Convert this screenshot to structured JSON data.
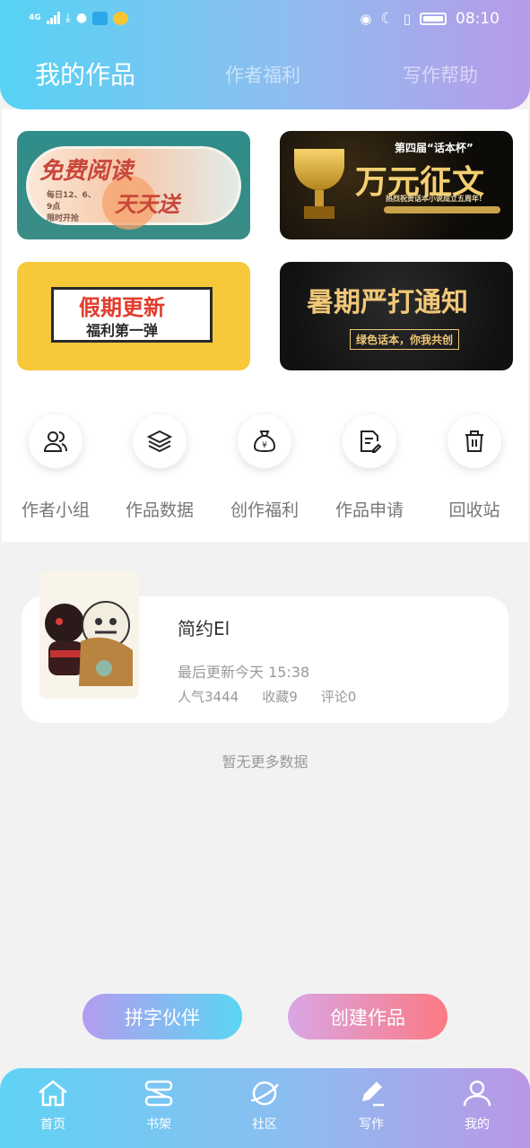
{
  "status_bar": {
    "network": "4G",
    "time": "08:10"
  },
  "tabs": [
    {
      "label": "我的作品",
      "active": true
    },
    {
      "label": "作者福利",
      "active": false
    },
    {
      "label": "写作帮助",
      "active": false
    }
  ],
  "banners": [
    {
      "title": "免费阅读",
      "subtitle": "天天送",
      "note": "每日12、6、9点\n限时开抢"
    },
    {
      "title": "万元征文",
      "subtitle": "第四届“话本杯”",
      "note": "热烈祝贺话本小说成立五周年!"
    },
    {
      "title": "假期更新",
      "subtitle": "福利第一弹"
    },
    {
      "title": "暑期严打通知",
      "subtitle": "绿色话本，你我共创"
    }
  ],
  "quick_links": [
    {
      "label": "作者小组",
      "icon": "users-icon"
    },
    {
      "label": "作品数据",
      "icon": "layers-icon"
    },
    {
      "label": "创作福利",
      "icon": "money-bag-icon"
    },
    {
      "label": "作品申请",
      "icon": "document-edit-icon"
    },
    {
      "label": "回收站",
      "icon": "trash-icon"
    }
  ],
  "work": {
    "title": "简约El",
    "updated": "最后更新今天 15:38",
    "popularity": "人气3444",
    "favorites": "收藏9",
    "comments": "评论0"
  },
  "no_more": "暂无更多数据",
  "actions": {
    "partner": "拼字伙伴",
    "create": "创建作品"
  },
  "nav": [
    {
      "label": "首页",
      "icon": "home-icon"
    },
    {
      "label": "书架",
      "icon": "bookshelf-icon"
    },
    {
      "label": "社区",
      "icon": "planet-icon"
    },
    {
      "label": "写作",
      "icon": "pen-icon"
    },
    {
      "label": "我的",
      "icon": "user-icon"
    }
  ],
  "colors": {
    "header_start": "#55d3f4",
    "header_end": "#b79be8",
    "create_start": "#d9a6e6",
    "create_end": "#fb7a83"
  }
}
